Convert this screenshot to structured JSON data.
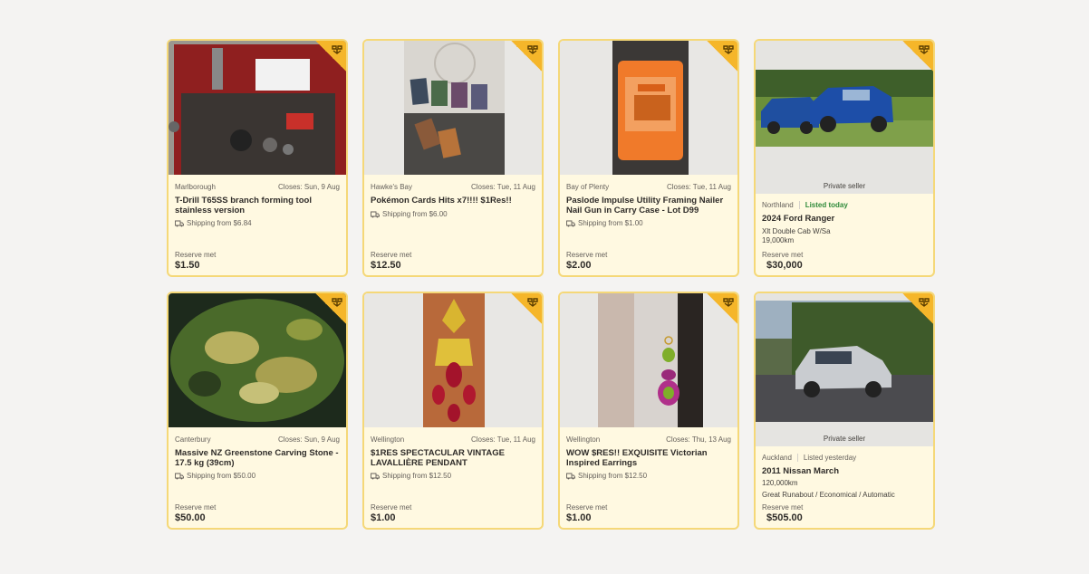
{
  "listings": [
    {
      "location": "Marlborough",
      "closes": "Closes: Sun, 9 Aug",
      "title": "T-Drill T65SS branch forming tool stainless version",
      "shipping": "Shipping from $6.84",
      "reserve": "Reserve met",
      "price": "$1.50"
    },
    {
      "location": "Hawke's Bay",
      "closes": "Closes: Tue, 11 Aug",
      "title": "Pokémon Cards Hits x7!!!! $1Res!!",
      "shipping": "Shipping from $6.00",
      "reserve": "Reserve met",
      "price": "$12.50"
    },
    {
      "location": "Bay of Plenty",
      "closes": "Closes: Tue, 11 Aug",
      "title": "Paslode Impulse Utility Framing Nailer Nail Gun in Carry Case - Lot D99",
      "shipping": "Shipping from $1.00",
      "reserve": "Reserve met",
      "price": "$2.00"
    },
    {
      "location": "Northland",
      "listed": "Listed today",
      "private": "Private seller",
      "title": "2024 Ford Ranger",
      "line1": "Xlt Double Cab W/Sa",
      "line2": "19,000km",
      "reserve": "Reserve met",
      "price": "$30,000"
    },
    {
      "location": "Canterbury",
      "closes": "Closes: Sun, 9 Aug",
      "title": "Massive NZ Greenstone Carving Stone - 17.5 kg (39cm)",
      "shipping": "Shipping from $50.00",
      "reserve": "Reserve met",
      "price": "$50.00"
    },
    {
      "location": "Wellington",
      "closes": "Closes: Tue, 11 Aug",
      "title": "$1RES SPECTACULAR VINTAGE LAVALLIÈRE PENDANT",
      "shipping": "Shipping from $12.50",
      "reserve": "Reserve met",
      "price": "$1.00"
    },
    {
      "location": "Wellington",
      "closes": "Closes: Thu, 13 Aug",
      "title": "WOW $RES!! EXQUISITE Victorian Inspired Earrings",
      "shipping": "Shipping from $12.50",
      "reserve": "Reserve met",
      "price": "$1.00"
    },
    {
      "location": "Auckland",
      "listed": "Listed yesterday",
      "private": "Private seller",
      "title": "2011 Nissan March",
      "line1": "120,000km",
      "line2": "Great Runabout / Economical / Automatic",
      "reserve": "Reserve met",
      "price": "$505.00"
    }
  ],
  "colors": {
    "card_bg": "#fff9e1",
    "card_border": "#f5d878",
    "badge": "#f5b62a",
    "listed_today": "#2f8a3a"
  },
  "icons": {
    "badge": "super-feature-icon",
    "shipping": "truck-icon"
  }
}
